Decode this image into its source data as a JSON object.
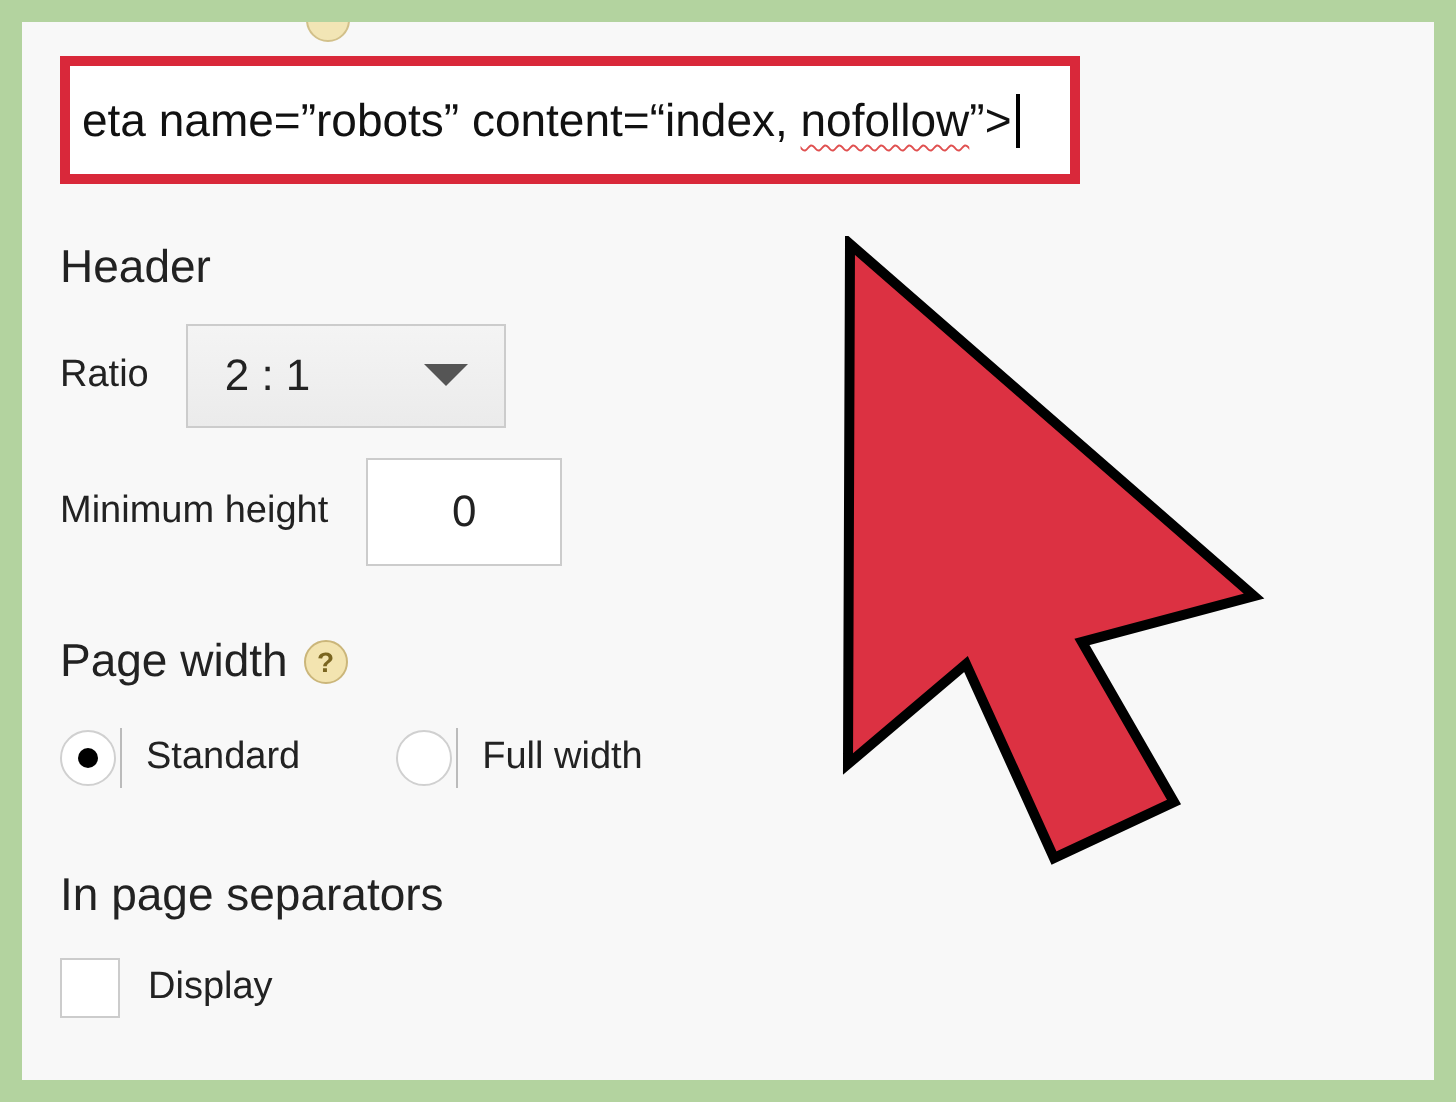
{
  "code_field": {
    "highlighted": true,
    "parts": [
      {
        "text": "eta name=”robots” content=“index, ",
        "misspelled": false
      },
      {
        "text": "nofollow",
        "misspelled": true
      },
      {
        "text": "”>",
        "misspelled": false
      }
    ]
  },
  "header": {
    "title": "Header",
    "ratio": {
      "label": "Ratio",
      "value": "2 : 1"
    },
    "min_height": {
      "label": "Minimum height",
      "value": "0"
    }
  },
  "page_width": {
    "title": "Page width",
    "help": "?",
    "options": [
      {
        "label": "Standard",
        "selected": true
      },
      {
        "label": "Full width",
        "selected": false
      }
    ]
  },
  "separators": {
    "title": "In page separators",
    "display": {
      "label": "Display",
      "checked": false
    }
  }
}
